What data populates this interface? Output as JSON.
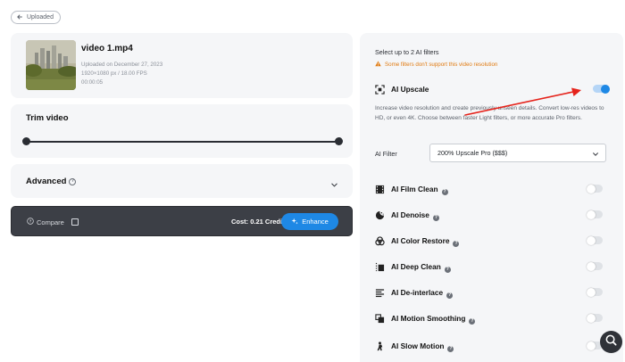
{
  "back_button": {
    "label": "Uploaded"
  },
  "video": {
    "title": "video 1.mp4",
    "uploaded": "Uploaded on December 27, 2023",
    "specs": "1920×1080 px / 18.00 FPS",
    "duration": "00:00:05"
  },
  "trim": {
    "title": "Trim video",
    "start": 0,
    "end": 1
  },
  "advanced": {
    "title": "Advanced"
  },
  "action_bar": {
    "compare_label": "Compare",
    "cost_label": "Cost: 0.21 Credits",
    "enhance_label": "Enhance"
  },
  "filters_panel": {
    "heading": "Select up to 2 AI filters",
    "warning": "Some filters don't support this video resolution",
    "upscale": {
      "label": "AI Upscale",
      "enabled": true,
      "description": "Increase video resolution and create previously unseen details. Convert low-res videos to HD, or even 4K. Choose between faster Light filters, or more accurate Pro filters.",
      "filter_label": "AI Filter",
      "filter_value": "200% Upscale Pro ($$$)"
    },
    "items": [
      {
        "label": "AI Film Clean",
        "icon": "film-icon",
        "enabled": false
      },
      {
        "label": "AI Denoise",
        "icon": "denoise-icon",
        "enabled": false
      },
      {
        "label": "AI Color Restore",
        "icon": "color-restore-icon",
        "enabled": false
      },
      {
        "label": "AI Deep Clean",
        "icon": "deep-clean-icon",
        "enabled": false
      },
      {
        "label": "AI De-interlace",
        "icon": "deinterlace-icon",
        "enabled": false
      },
      {
        "label": "AI Motion Smoothing",
        "icon": "motion-smoothing-icon",
        "enabled": false
      },
      {
        "label": "AI Slow Motion",
        "icon": "slow-motion-icon",
        "enabled": false
      }
    ]
  },
  "colors": {
    "accent": "#1e88e5",
    "warning": "#e07b12",
    "arrow": "#e5231b",
    "dark_bar": "#3c3f46"
  }
}
